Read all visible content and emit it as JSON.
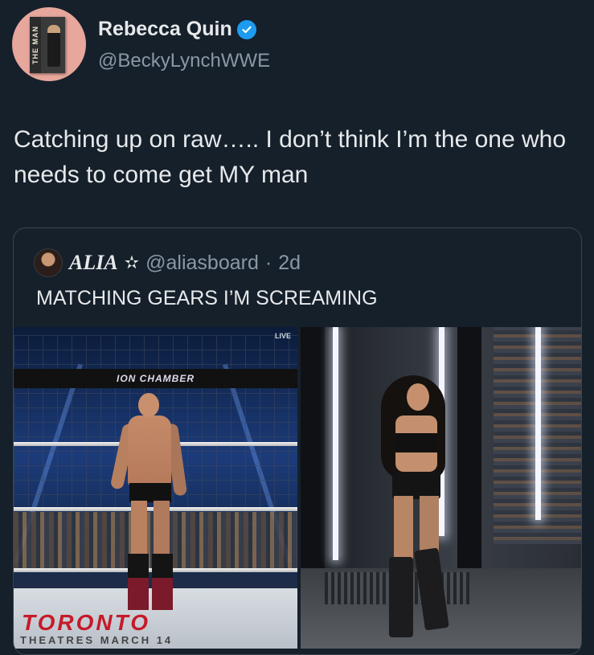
{
  "tweet": {
    "author_name": "Rebecca Quin",
    "handle": "@BeckyLynchWWE",
    "verified": true,
    "text": "Catching up on raw….. I don’t think I’m the one who needs to come get MY man",
    "avatar": {
      "book_spine_text": "THE MAN",
      "background": "#e7a79c"
    }
  },
  "quoted_tweet": {
    "author_name": "ALIA",
    "badge_icon": "star-outline-icon",
    "badge_glyph": "✫",
    "handle": "@aliasboard",
    "separator": "·",
    "time": "2d",
    "text": "MATCHING GEARS I’M SCREAMING",
    "media": [
      {
        "name": "wrestler-in-ring-photo",
        "banner_text": "ION CHAMBER",
        "live_logo": "LIVE",
        "apron_text": "TORONTO",
        "apron_sub": "THEATRES MARCH 14"
      },
      {
        "name": "wrestler-entrance-photo"
      }
    ]
  },
  "colors": {
    "background": "#15202b",
    "text_primary": "#e7e9ea",
    "text_secondary": "#8b98a5",
    "verified": "#1d9bf0",
    "border": "#38444d"
  }
}
